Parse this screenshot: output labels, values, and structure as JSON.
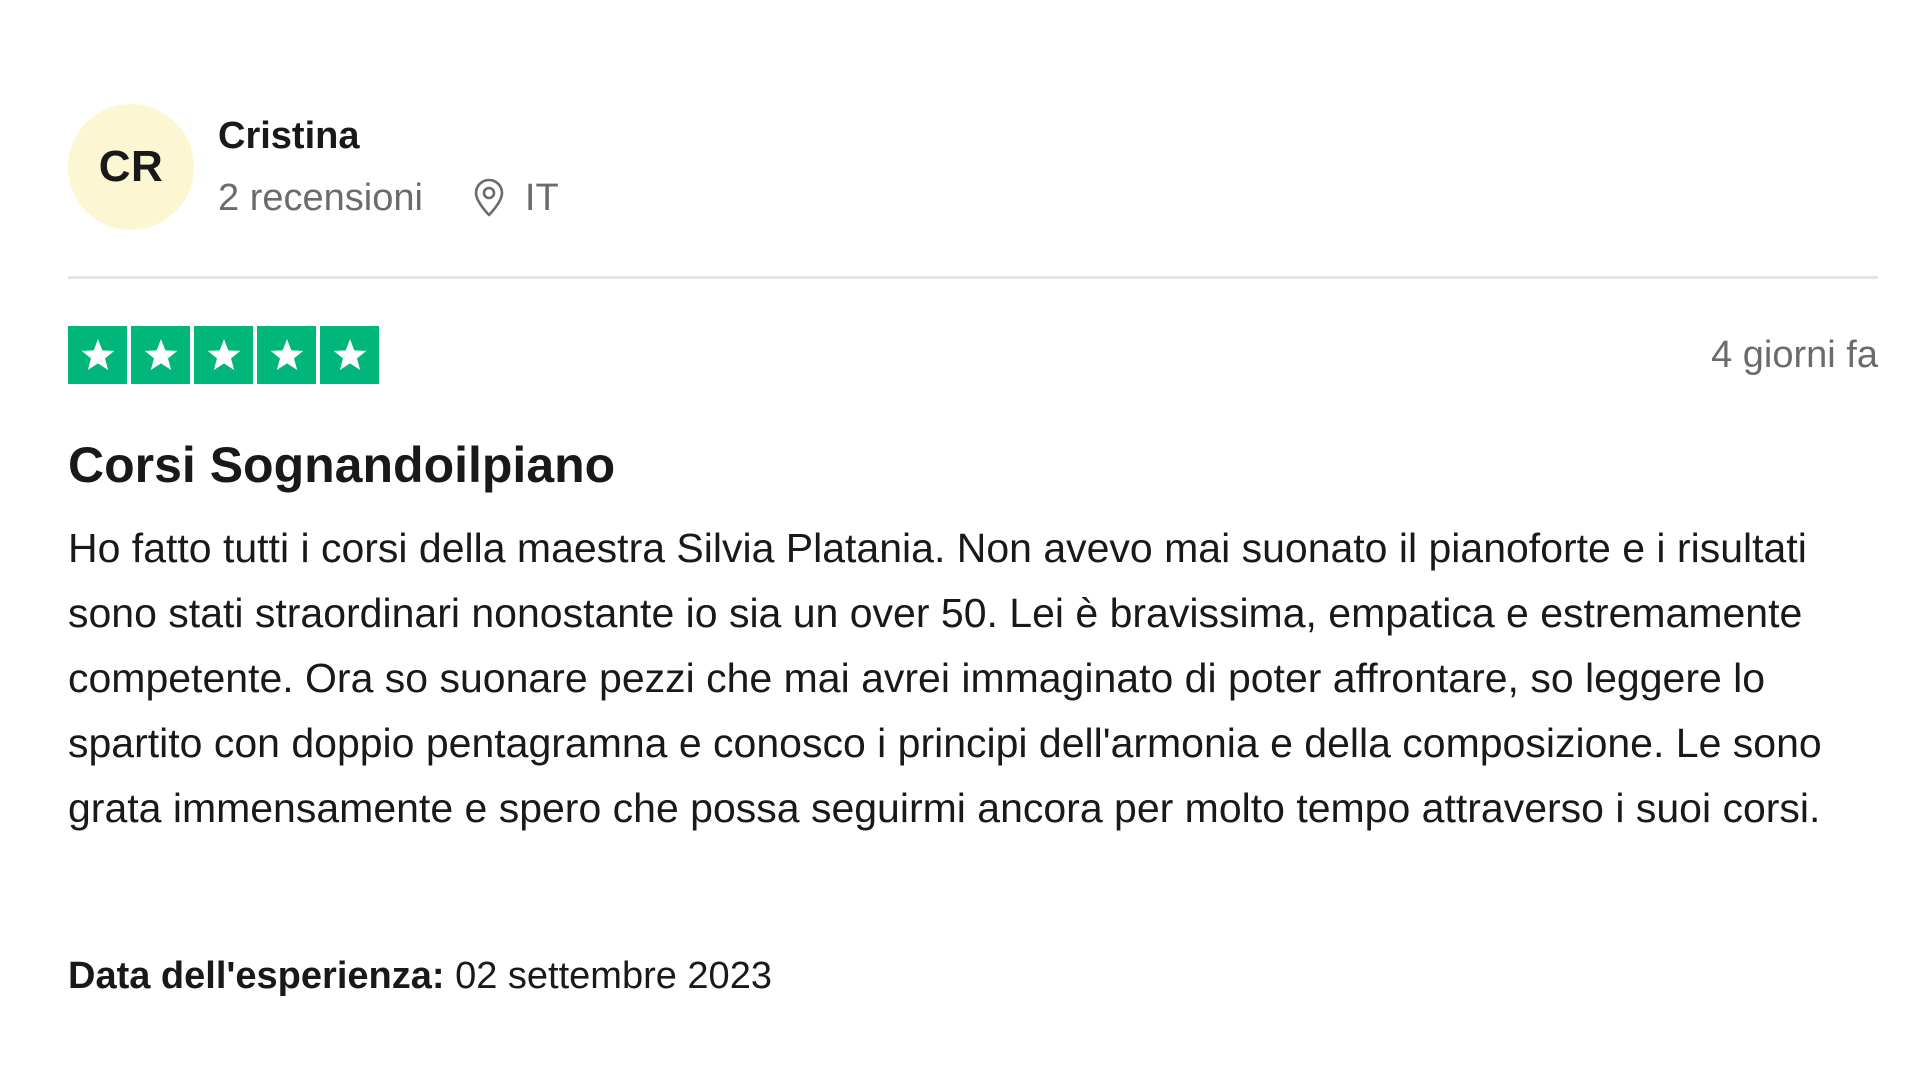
{
  "reviewer": {
    "initials": "CR",
    "name": "Cristina",
    "reviews_count": "2 recensioni",
    "country": "IT",
    "avatar_color": "#fcf7d2"
  },
  "review": {
    "rating": 5,
    "max_rating": 5,
    "star_color": "#00b67a",
    "date_ago": "4 giorni fa",
    "title": "Corsi Sognandoilpiano",
    "body": "Ho fatto tutti i corsi della maestra Silvia Platania. Non avevo mai suonato il pianoforte e i risultati sono stati straordinari nonostante io sia un over 50. Lei è bravissima, empatica e estremamente competente. Ora so suonare pezzi che mai avrei immaginato di poter affrontare, so leggere lo spartito con doppio pentagramna e conosco i principi dell'armonia e della composizione. Le sono grata immensamente e spero che possa seguirmi ancora per molto tempo attraverso i suoi corsi.",
    "experience_label": "Data dell'esperienza:",
    "experience_date": "02 settembre 2023"
  },
  "icons": {
    "location": "location-pin-icon",
    "star": "star-icon"
  }
}
